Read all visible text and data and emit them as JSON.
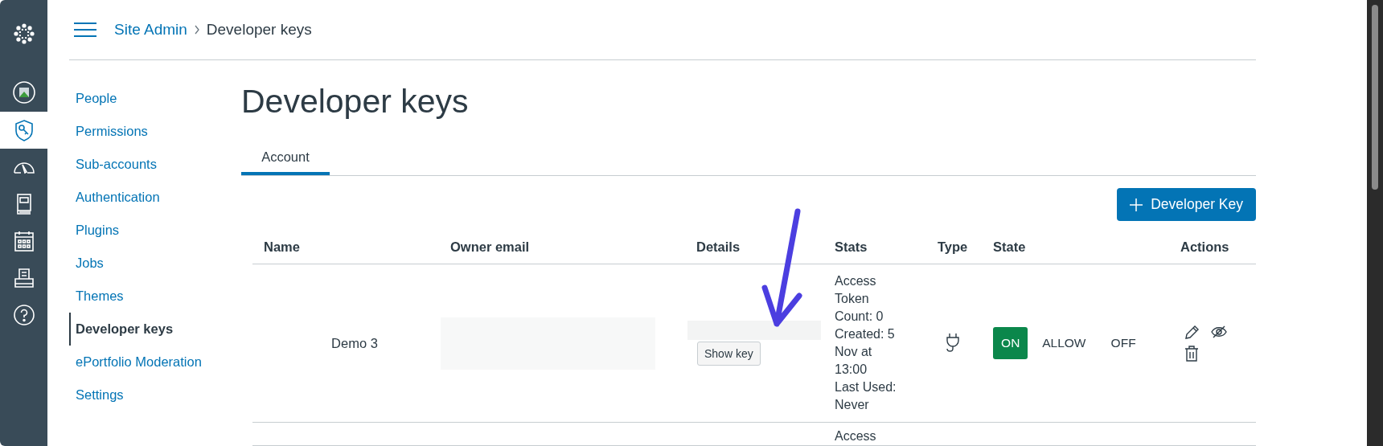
{
  "rail": [
    {
      "kind": "logo",
      "selected": false
    },
    {
      "kind": "avatar",
      "selected": false
    },
    {
      "kind": "admin",
      "selected": true
    },
    {
      "kind": "dashboard",
      "selected": false
    },
    {
      "kind": "courses",
      "selected": false
    },
    {
      "kind": "calendar",
      "selected": false
    },
    {
      "kind": "inbox",
      "selected": false
    },
    {
      "kind": "help",
      "selected": false
    }
  ],
  "breadcrumb": [
    {
      "label": "Site Admin",
      "kind": "link"
    },
    {
      "label": "Developer keys",
      "kind": "current"
    }
  ],
  "sidebar": {
    "items": [
      {
        "label": "People",
        "selected": false
      },
      {
        "label": "Permissions",
        "selected": false
      },
      {
        "label": "Sub-accounts",
        "selected": false
      },
      {
        "label": "Authentication",
        "selected": false
      },
      {
        "label": "Plugins",
        "selected": false
      },
      {
        "label": "Jobs",
        "selected": false
      },
      {
        "label": "Themes",
        "selected": false
      },
      {
        "label": "Developer keys",
        "selected": true
      },
      {
        "label": "ePortfolio Moderation",
        "selected": false
      },
      {
        "label": "Settings",
        "selected": false
      }
    ]
  },
  "title": "Developer keys",
  "tabs": [
    {
      "label": "Account",
      "selected": true
    }
  ],
  "add_button": {
    "label": "Developer Key"
  },
  "table": {
    "columns": [
      "Name",
      "Owner email",
      "Details",
      "Stats",
      "Type",
      "State",
      "Actions"
    ],
    "rows": [
      {
        "name": "Demo 3",
        "details_button": "Show key",
        "stats": [
          "Access Token Count: 0",
          "Created: 5 Nov at 13:00",
          "Last Used: Never"
        ],
        "state_options": [
          {
            "label": "ON",
            "selected": true
          },
          {
            "label": "ALLOW",
            "selected": false
          },
          {
            "label": "OFF",
            "selected": false
          }
        ]
      },
      {
        "stats": [
          "Access"
        ]
      }
    ]
  }
}
